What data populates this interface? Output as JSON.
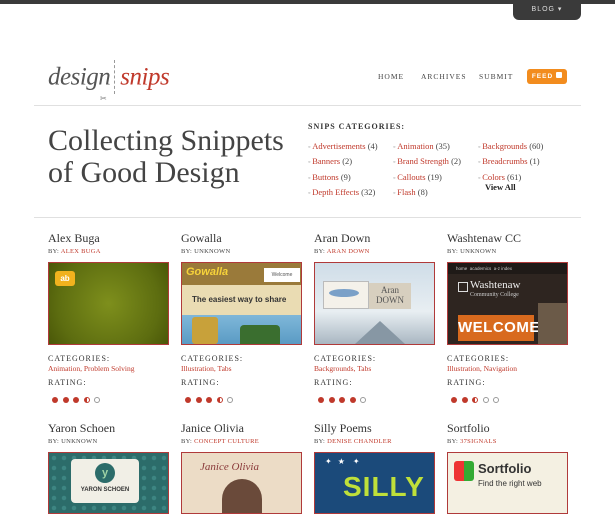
{
  "header": {
    "blog_label": "BLOG ▾",
    "logo_left": "design",
    "logo_right": "snips",
    "nav": [
      "HOME",
      "ARCHIVES",
      "SUBMIT"
    ],
    "feed_label": "FEED"
  },
  "hero": {
    "headline": "Collecting Snippets of Good Design"
  },
  "categories": {
    "title": "SNIPS CATEGORIES:",
    "columns": [
      [
        {
          "name": "Advertisements",
          "count": "(4)"
        },
        {
          "name": "Banners",
          "count": "(2)"
        },
        {
          "name": "Buttons",
          "count": "(9)"
        },
        {
          "name": "Depth Effects",
          "count": "(32)"
        }
      ],
      [
        {
          "name": "Animation",
          "count": "(35)"
        },
        {
          "name": "Brand Strength",
          "count": "(2)"
        },
        {
          "name": "Callouts",
          "count": "(19)"
        },
        {
          "name": "Flash",
          "count": "(8)"
        }
      ],
      [
        {
          "name": "Backgrounds",
          "count": "(60)"
        },
        {
          "name": "Breadcrumbs",
          "count": "(1)"
        },
        {
          "name": "Colors",
          "count": "(61)"
        }
      ]
    ],
    "view_all": "View All"
  },
  "labels": {
    "by": "BY:",
    "categories": "CATEGORIES:",
    "rating": "RATING:"
  },
  "snips": [
    {
      "name": "Alex Buga",
      "by": "ALEX BUGA",
      "categories": "Animation, Problem Solving",
      "rating": 3.5,
      "thumb_text": "ab"
    },
    {
      "name": "Gowalla",
      "by": "UNKNOWN",
      "categories": "Illustration, Tabs",
      "rating": 3.5,
      "thumb_text": "Gowalla",
      "thumb_text2": "The easiest way to share",
      "thumb_text3": "Welcome"
    },
    {
      "name": "Aran Down",
      "by": "ARAN DOWN",
      "categories": "Backgrounds, Tabs",
      "rating": 4,
      "thumb_text": "Aran DOWN"
    },
    {
      "name": "Washtenaw CC",
      "by": "UNKNOWN",
      "categories": "Illustration, Navigation",
      "rating": 2.5,
      "thumb_text": "Washtenaw",
      "thumb_text2": "Community College",
      "thumb_text3": "WELCOME",
      "thumb_nav": "home  academics  a-z index"
    },
    {
      "name": "Yaron Schoen",
      "by": "UNKNOWN",
      "thumb_text": "YARON SCHOEN"
    },
    {
      "name": "Janice Olivia",
      "by": "CONCEPT CULTURE",
      "thumb_text": "Janice Olivia"
    },
    {
      "name": "Silly Poems",
      "by": "DENISE CHANDLER",
      "thumb_text": "SILLY"
    },
    {
      "name": "Sortfolio",
      "by": "37SIGNALS",
      "thumb_text": "Sortfolio",
      "thumb_text2": "Find the right web"
    }
  ],
  "colors": {
    "accent": "#c0392b",
    "feed": "#f28c1e",
    "topbar": "#3a3a3a"
  }
}
